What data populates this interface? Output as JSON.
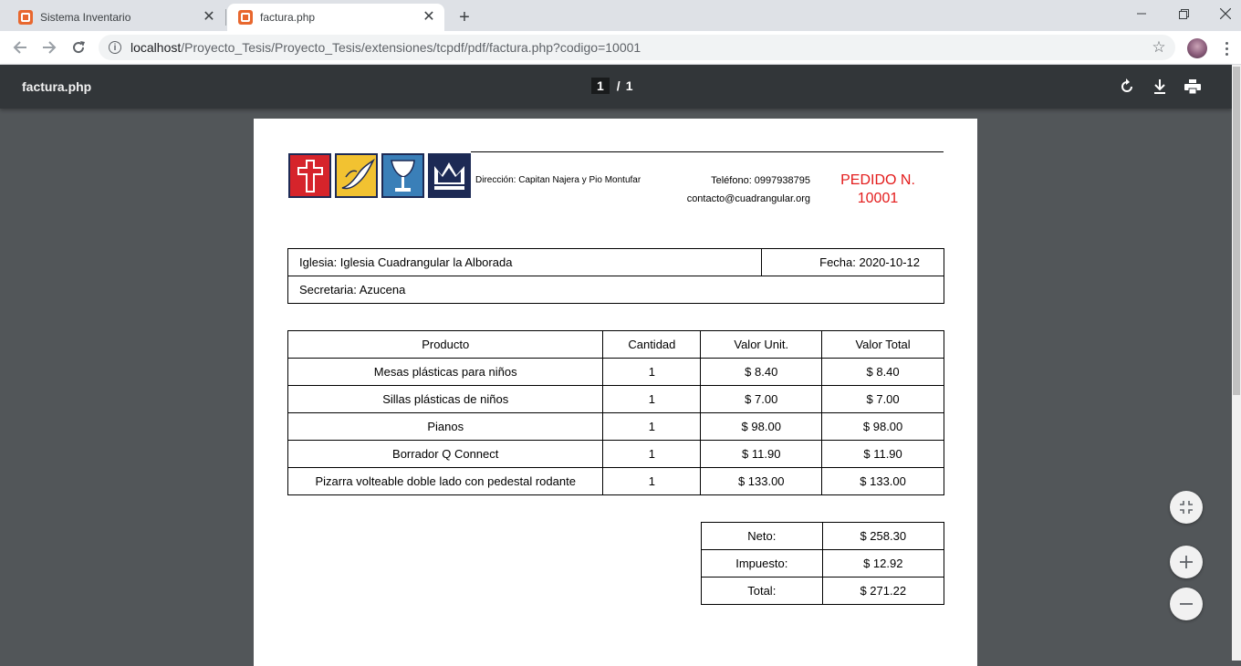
{
  "browser": {
    "tabs": [
      {
        "title": "Sistema Inventario"
      },
      {
        "title": "factura.php"
      }
    ],
    "url": {
      "host": "localhost",
      "path": "/Proyecto_Tesis/Proyecto_Tesis/extensiones/tcpdf/pdf/factura.php?codigo=10001"
    }
  },
  "pdf_viewer": {
    "filename": "factura.php",
    "current_page": "1",
    "separator": "/",
    "total_pages": "1"
  },
  "invoice": {
    "direccion": "Dirección: Capitan Najera y Pio Montufar",
    "telefono": "Teléfono: 0997938795",
    "correo": "contacto@cuadrangular.org",
    "pedido_label": "PEDIDO N.",
    "pedido_numero": "10001",
    "iglesia": "Iglesia: Iglesia Cuadrangular la Alborada",
    "fecha": "Fecha: 2020-10-12",
    "secretaria": "Secretaria: Azucena",
    "columns": [
      "Producto",
      "Cantidad",
      "Valor Unit.",
      "Valor Total"
    ],
    "items": [
      {
        "producto": "Mesas plásticas para niños",
        "cantidad": "1",
        "unit": "$ 8.40",
        "total": "$ 8.40"
      },
      {
        "producto": "Sillas plásticas de niños",
        "cantidad": "1",
        "unit": "$ 7.00",
        "total": "$ 7.00"
      },
      {
        "producto": "Pianos",
        "cantidad": "1",
        "unit": "$ 98.00",
        "total": "$ 98.00"
      },
      {
        "producto": "Borrador Q Connect",
        "cantidad": "1",
        "unit": "$ 11.90",
        "total": "$ 11.90"
      },
      {
        "producto": "Pizarra volteable doble lado con pedestal rodante",
        "cantidad": "1",
        "unit": "$ 133.00",
        "total": "$ 133.00"
      }
    ],
    "totals": [
      {
        "label": "Neto:",
        "value": "$ 258.30"
      },
      {
        "label": "Impuesto:",
        "value": "$ 12.92"
      },
      {
        "label": "Total:",
        "value": "$ 271.22"
      }
    ]
  },
  "icons": {
    "tab_favicon": "xampp-icon",
    "tab_close": "close-icon",
    "new_tab": "plus-icon",
    "back": "back-arrow-icon",
    "forward": "forward-arrow-icon",
    "reload": "reload-icon",
    "site_info": "info-icon",
    "bookmark": "star-icon",
    "rotate": "rotate-icon",
    "download": "download-icon",
    "print": "print-icon",
    "fit": "fit-to-page-icon",
    "zoom_in": "zoom-in-icon",
    "zoom_out": "zoom-out-icon"
  },
  "colors": {
    "pedido": "#e31b1b",
    "pdf_toolbar": "#323639",
    "viewer_bg": "#525659"
  }
}
